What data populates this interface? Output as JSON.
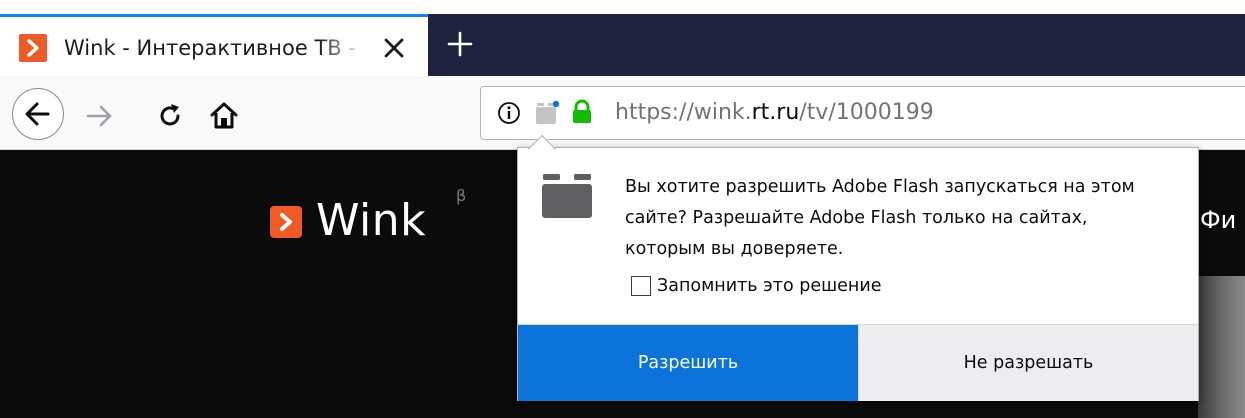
{
  "tab": {
    "title": "Wink - Интерактивное ТВ - Ма",
    "favicon": "wink-play-icon",
    "close_icon": "close-icon"
  },
  "new_tab_icon": "plus-icon",
  "toolbar": {
    "back_icon": "arrow-left-icon",
    "forward_icon": "arrow-right-icon",
    "reload_icon": "reload-icon",
    "home_icon": "home-icon"
  },
  "urlbar": {
    "scheme": "https://wink.",
    "host": "rt.ru",
    "path": "/tv/1000199",
    "info_icon": "info-icon",
    "plugin_icon": "plugin-icon",
    "lock_icon": "lock-icon"
  },
  "page": {
    "logo_text": "Wink",
    "logo_beta": "β",
    "nav_fragment": "Фи"
  },
  "flash_prompt": {
    "message": "Вы хотите разрешить Adobe Flash запускаться на этом сайте? Разрешайте Adobe Flash только на сайтах, которым вы доверяете.",
    "remember_label": "Запомнить это решение",
    "remember_checked": false,
    "allow_label": "Разрешить",
    "deny_label": "Не разрешать"
  },
  "colors": {
    "accent_blue": "#0a74da",
    "tab_accent": "#0a84ff",
    "brand_orange": "#ef5a25",
    "lock_green": "#12bc00",
    "tabstrip_dark": "#202340"
  }
}
